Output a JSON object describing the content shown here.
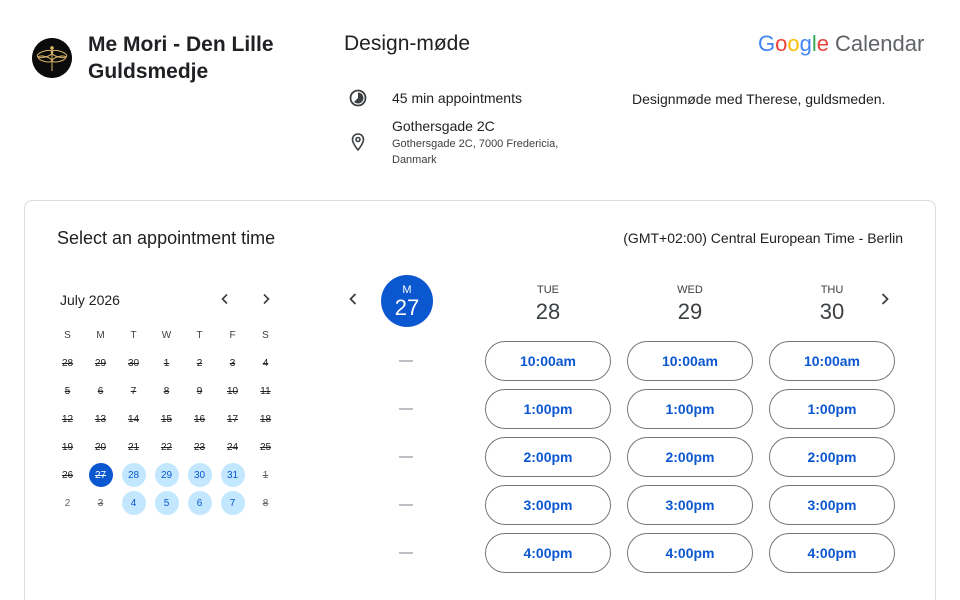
{
  "header": {
    "business_name": "Me Mori - Den Lille Guldsmedje",
    "event_title": "Design-møde",
    "logo": {
      "google": [
        "G",
        "o",
        "o",
        "g",
        "l",
        "e"
      ],
      "product": "Calendar"
    },
    "duration": "45 min appointments",
    "location_name": "Gothersgade 2C",
    "location_address": "Gothersgade 2C, 7000 Fredericia, Danmark",
    "description": "Designmøde med Therese, guldsmeden."
  },
  "booking": {
    "title": "Select an appointment time",
    "timezone": "(GMT+02:00) Central European Time - Berlin"
  },
  "mini_calendar": {
    "month": "July 2026",
    "weekdays": [
      "S",
      "M",
      "T",
      "W",
      "T",
      "F",
      "S"
    ],
    "weeks": [
      [
        {
          "d": "28",
          "s": "disabled"
        },
        {
          "d": "29",
          "s": "disabled"
        },
        {
          "d": "30",
          "s": "disabled"
        },
        {
          "d": "1",
          "s": "disabled"
        },
        {
          "d": "2",
          "s": "disabled"
        },
        {
          "d": "3",
          "s": "disabled"
        },
        {
          "d": "4",
          "s": "disabled"
        }
      ],
      [
        {
          "d": "5",
          "s": "disabled"
        },
        {
          "d": "6",
          "s": "disabled"
        },
        {
          "d": "7",
          "s": "disabled"
        },
        {
          "d": "8",
          "s": "disabled"
        },
        {
          "d": "9",
          "s": "disabled"
        },
        {
          "d": "10",
          "s": "disabled"
        },
        {
          "d": "11",
          "s": "disabled"
        }
      ],
      [
        {
          "d": "12",
          "s": "disabled"
        },
        {
          "d": "13",
          "s": "disabled"
        },
        {
          "d": "14",
          "s": "disabled"
        },
        {
          "d": "15",
          "s": "disabled"
        },
        {
          "d": "16",
          "s": "disabled"
        },
        {
          "d": "17",
          "s": "disabled"
        },
        {
          "d": "18",
          "s": "disabled"
        }
      ],
      [
        {
          "d": "19",
          "s": "disabled"
        },
        {
          "d": "20",
          "s": "disabled"
        },
        {
          "d": "21",
          "s": "disabled"
        },
        {
          "d": "22",
          "s": "disabled"
        },
        {
          "d": "23",
          "s": "disabled"
        },
        {
          "d": "24",
          "s": "disabled"
        },
        {
          "d": "25",
          "s": "disabled"
        }
      ],
      [
        {
          "d": "26",
          "s": "disabled"
        },
        {
          "d": "27",
          "s": "selected"
        },
        {
          "d": "28",
          "s": "avail"
        },
        {
          "d": "29",
          "s": "avail"
        },
        {
          "d": "30",
          "s": "avail"
        },
        {
          "d": "31",
          "s": "avail"
        },
        {
          "d": "1",
          "s": "other-disabled"
        }
      ],
      [
        {
          "d": "2",
          "s": "other"
        },
        {
          "d": "3",
          "s": "other-disabled"
        },
        {
          "d": "4",
          "s": "avail"
        },
        {
          "d": "5",
          "s": "avail"
        },
        {
          "d": "6",
          "s": "avail"
        },
        {
          "d": "7",
          "s": "avail"
        },
        {
          "d": "8",
          "s": "other-disabled"
        }
      ]
    ]
  },
  "week_view": {
    "selected_day": {
      "dow": "M",
      "date": "27"
    },
    "unavailable_rows": 5,
    "days": [
      {
        "dow": "TUE",
        "date": "28",
        "slots": [
          "10:00am",
          "1:00pm",
          "2:00pm",
          "3:00pm",
          "4:00pm"
        ]
      },
      {
        "dow": "WED",
        "date": "29",
        "slots": [
          "10:00am",
          "1:00pm",
          "2:00pm",
          "3:00pm",
          "4:00pm"
        ]
      },
      {
        "dow": "THU",
        "date": "30",
        "slots": [
          "10:00am",
          "1:00pm",
          "2:00pm",
          "3:00pm",
          "4:00pm"
        ]
      }
    ]
  },
  "colors": {
    "accent": "#0b57d0",
    "available_day": "#c2e7ff",
    "border": "#dadce0"
  },
  "icons": [
    "dragonfly-logo",
    "duration-icon",
    "location-pin-icon",
    "chevron-left-icon",
    "chevron-right-icon"
  ]
}
